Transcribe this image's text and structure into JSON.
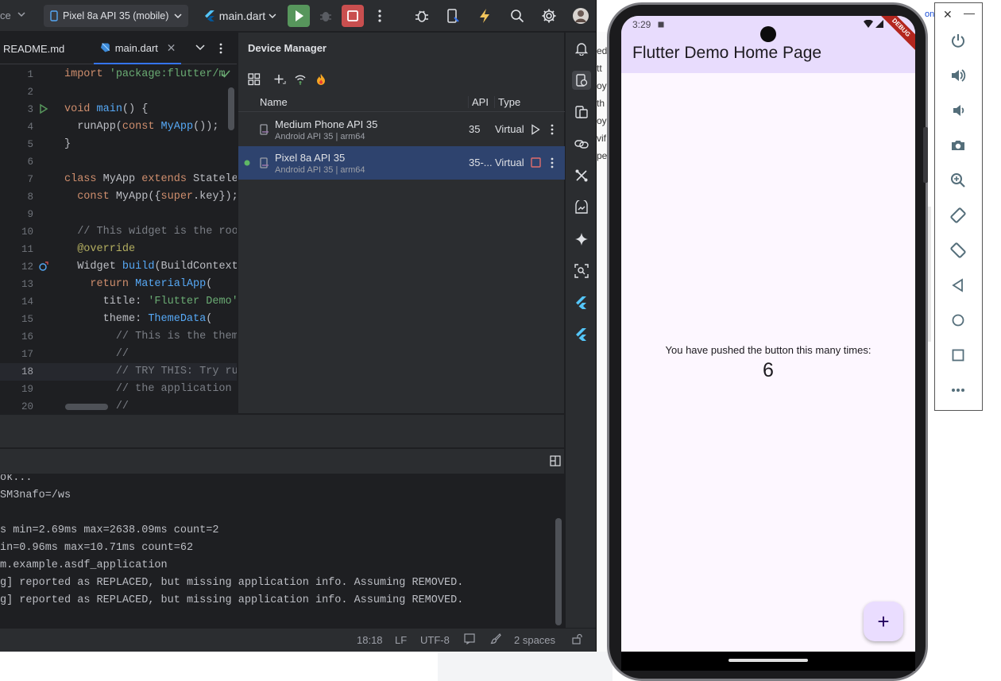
{
  "ide": {
    "device_selector": "Pixel 8a API 35 (mobile)",
    "run_config": "main.dart",
    "left_clipped_text": "ce",
    "tabs": [
      {
        "label": "README.md"
      },
      {
        "label": "main.dart"
      }
    ],
    "code_lines": [
      {
        "n": "1",
        "html": "<span class=\"kw\">import</span> <span class=\"str\">'package:flutter/m</span>"
      },
      {
        "n": "2",
        "html": ""
      },
      {
        "n": "3",
        "html": "<span class=\"kw\">void</span> <span class=\"fn\">main</span>() {"
      },
      {
        "n": "4",
        "html": "  runApp(<span class=\"kw\">const</span> <span class=\"cls\">MyApp</span>());"
      },
      {
        "n": "5",
        "html": "}"
      },
      {
        "n": "6",
        "html": ""
      },
      {
        "n": "7",
        "html": "<span class=\"kw\">class</span> MyApp <span class=\"kw\">extends</span> Stateles"
      },
      {
        "n": "8",
        "html": "  <span class=\"kw\">const</span> MyApp({<span class=\"kw\">super</span>.key});"
      },
      {
        "n": "9",
        "html": ""
      },
      {
        "n": "10",
        "html": "  <span class=\"cmt\">// This widget is the root</span>"
      },
      {
        "n": "11",
        "html": "  <span class=\"ann\">@override</span>"
      },
      {
        "n": "12",
        "html": "  Widget <span class=\"fn\">build</span>(BuildContext"
      },
      {
        "n": "13",
        "html": "    <span class=\"kw\">return</span> <span class=\"cls\">MaterialApp</span>("
      },
      {
        "n": "14",
        "html": "      title: <span class=\"str\">'Flutter Demo'</span>,"
      },
      {
        "n": "15",
        "html": "      theme: <span class=\"cls\">ThemeData</span>("
      },
      {
        "n": "16",
        "html": "        <span class=\"cmt\">// This is the theme</span>"
      },
      {
        "n": "17",
        "html": "        <span class=\"cmt\">//</span>"
      },
      {
        "n": "18",
        "html": "        <span class=\"cmt\">// TRY THIS: Try run</span>"
      },
      {
        "n": "19",
        "html": "        <span class=\"cmt\">// the application h</span>"
      },
      {
        "n": "20",
        "html": "        <span class=\"cmt\">// </span>"
      }
    ],
    "current_line": "18",
    "device_manager": {
      "title": "Device Manager",
      "columns": {
        "name": "Name",
        "api": "API",
        "type": "Type"
      },
      "devices": [
        {
          "name": "Medium Phone API 35",
          "sub": "Android API 35 | arm64",
          "api": "35",
          "type": "Virtual",
          "running": false
        },
        {
          "name": "Pixel 8a API 35",
          "sub": "Android API 35 | arm64",
          "api": "35-...",
          "type": "Virtual",
          "running": true
        }
      ]
    },
    "console_lines": [
      "ok...",
      "SM3nafo=/ws",
      "",
      "s min=2.69ms max=2638.09ms count=2",
      "in=0.96ms max=10.71ms count=62",
      "m.example.asdf_application",
      "g] reported as REPLACED, but missing application info. Assuming REMOVED.",
      "g] reported as REPLACED, but missing application info. Assuming REMOVED."
    ],
    "status": {
      "position": "18:18",
      "line_ending": "LF",
      "encoding": "UTF-8",
      "indent": "2 spaces"
    }
  },
  "background_window": {
    "fragments": [
      "ed",
      "tt",
      "oy",
      "th",
      "oy",
      "vif",
      "pe"
    ],
    "right_fragment": "on"
  },
  "phone": {
    "status_time": "3:29",
    "app_title": "Flutter Demo Home Page",
    "debug_banner": "DEBUG",
    "counter_label": "You have pushed the button this many times:",
    "counter_value": "6",
    "fab_symbol": "+"
  },
  "emulator_toolbar": {
    "close": "✕",
    "minimize": "—",
    "buttons": [
      "power-icon",
      "volume-up-icon",
      "volume-down-icon",
      "camera-icon",
      "zoom-icon",
      "rotate-left-icon",
      "rotate-right-icon",
      "back-icon",
      "home-icon",
      "overview-icon",
      "more-icon"
    ]
  }
}
